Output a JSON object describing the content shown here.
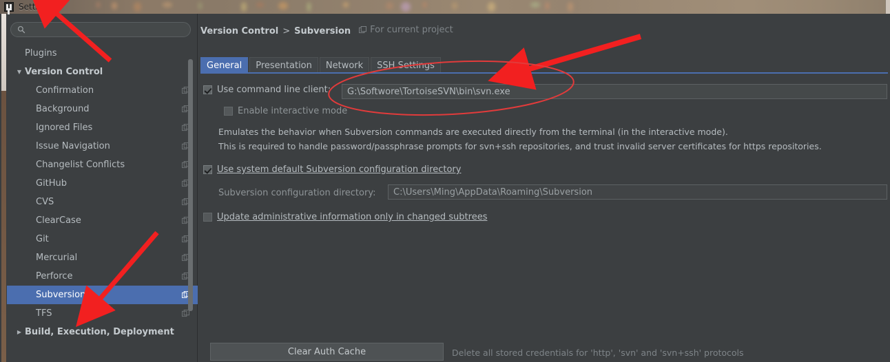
{
  "window": {
    "title": "Settings",
    "app_icon": "intellij-idea-logo-icon"
  },
  "sidebar": {
    "search": {
      "value": "",
      "placeholder": "",
      "icon": "search-icon"
    },
    "items": [
      {
        "label": "Plugins",
        "level": 0,
        "twisty": "",
        "copy": false,
        "selected": false,
        "group": false
      },
      {
        "label": "Version Control",
        "level": 0,
        "twisty": "▼",
        "copy": false,
        "selected": false,
        "group": true
      },
      {
        "label": "Confirmation",
        "level": 1,
        "twisty": "",
        "copy": true,
        "selected": false,
        "group": false
      },
      {
        "label": "Background",
        "level": 1,
        "twisty": "",
        "copy": true,
        "selected": false,
        "group": false
      },
      {
        "label": "Ignored Files",
        "level": 1,
        "twisty": "",
        "copy": true,
        "selected": false,
        "group": false
      },
      {
        "label": "Issue Navigation",
        "level": 1,
        "twisty": "",
        "copy": true,
        "selected": false,
        "group": false
      },
      {
        "label": "Changelist Conflicts",
        "level": 1,
        "twisty": "",
        "copy": true,
        "selected": false,
        "group": false
      },
      {
        "label": "GitHub",
        "level": 1,
        "twisty": "",
        "copy": true,
        "selected": false,
        "group": false
      },
      {
        "label": "CVS",
        "level": 1,
        "twisty": "",
        "copy": true,
        "selected": false,
        "group": false
      },
      {
        "label": "ClearCase",
        "level": 1,
        "twisty": "",
        "copy": true,
        "selected": false,
        "group": false
      },
      {
        "label": "Git",
        "level": 1,
        "twisty": "",
        "copy": true,
        "selected": false,
        "group": false
      },
      {
        "label": "Mercurial",
        "level": 1,
        "twisty": "",
        "copy": true,
        "selected": false,
        "group": false
      },
      {
        "label": "Perforce",
        "level": 1,
        "twisty": "",
        "copy": true,
        "selected": false,
        "group": false
      },
      {
        "label": "Subversion",
        "level": 1,
        "twisty": "",
        "copy": true,
        "selected": true,
        "group": false
      },
      {
        "label": "TFS",
        "level": 1,
        "twisty": "",
        "copy": true,
        "selected": false,
        "group": false
      },
      {
        "label": "Build, Execution, Deployment",
        "level": 0,
        "twisty": "▶",
        "copy": false,
        "selected": false,
        "group": true
      }
    ]
  },
  "content": {
    "breadcrumb": {
      "root": "Version Control",
      "separator": ">",
      "leaf": "Subversion",
      "scope_icon": "project-scope-icon",
      "scope_label": "For current project"
    },
    "tabs": [
      {
        "label": "General",
        "active": true
      },
      {
        "label": "Presentation",
        "active": false
      },
      {
        "label": "Network",
        "active": false
      },
      {
        "label": "SSH Settings",
        "active": false
      }
    ],
    "general": {
      "use_command_line_client": {
        "label": "Use command line client:",
        "mnemonic_prefix": "",
        "checked": true,
        "path_value": "G:\\Softwore\\TortoiseSVN\\bin\\svn.exe"
      },
      "enable_interactive_mode": {
        "label": "Enable interactive mode",
        "checked": false,
        "enabled": false
      },
      "interactive_desc_line1": "Emulates the behavior when Subversion commands are executed directly from the terminal (in the interactive mode).",
      "interactive_desc_line2": "This is required to handle password/passphrase prompts for svn+ssh repositories, and trust invalid server certificates for https repositories.",
      "use_system_default_config": {
        "label": "Use system default Subversion configuration directory",
        "checked": true
      },
      "config_dir": {
        "label": "Subversion configuration directory:",
        "value": "C:\\Users\\Ming\\AppData\\Roaming\\Subversion"
      },
      "update_admin_info": {
        "label": "Update administrative information only in changed subtrees",
        "checked": false
      },
      "clear_auth_cache": {
        "button_label": "Clear Auth Cache",
        "note": "Delete all stored credentials for 'http', 'svn' and 'svn+ssh' protocols"
      }
    }
  },
  "annotations": {
    "color": "#f22020",
    "ellipse_color": "#e23b3b",
    "arrow_to_title": "arrow-pointing-to-settings-title",
    "arrow_to_sidebar": "arrow-pointing-to-subversion-item",
    "arrow_to_path": "arrow-pointing-to-command-line-path",
    "ellipse_around_path": "ellipse-highlighting-command-line-client-row"
  }
}
